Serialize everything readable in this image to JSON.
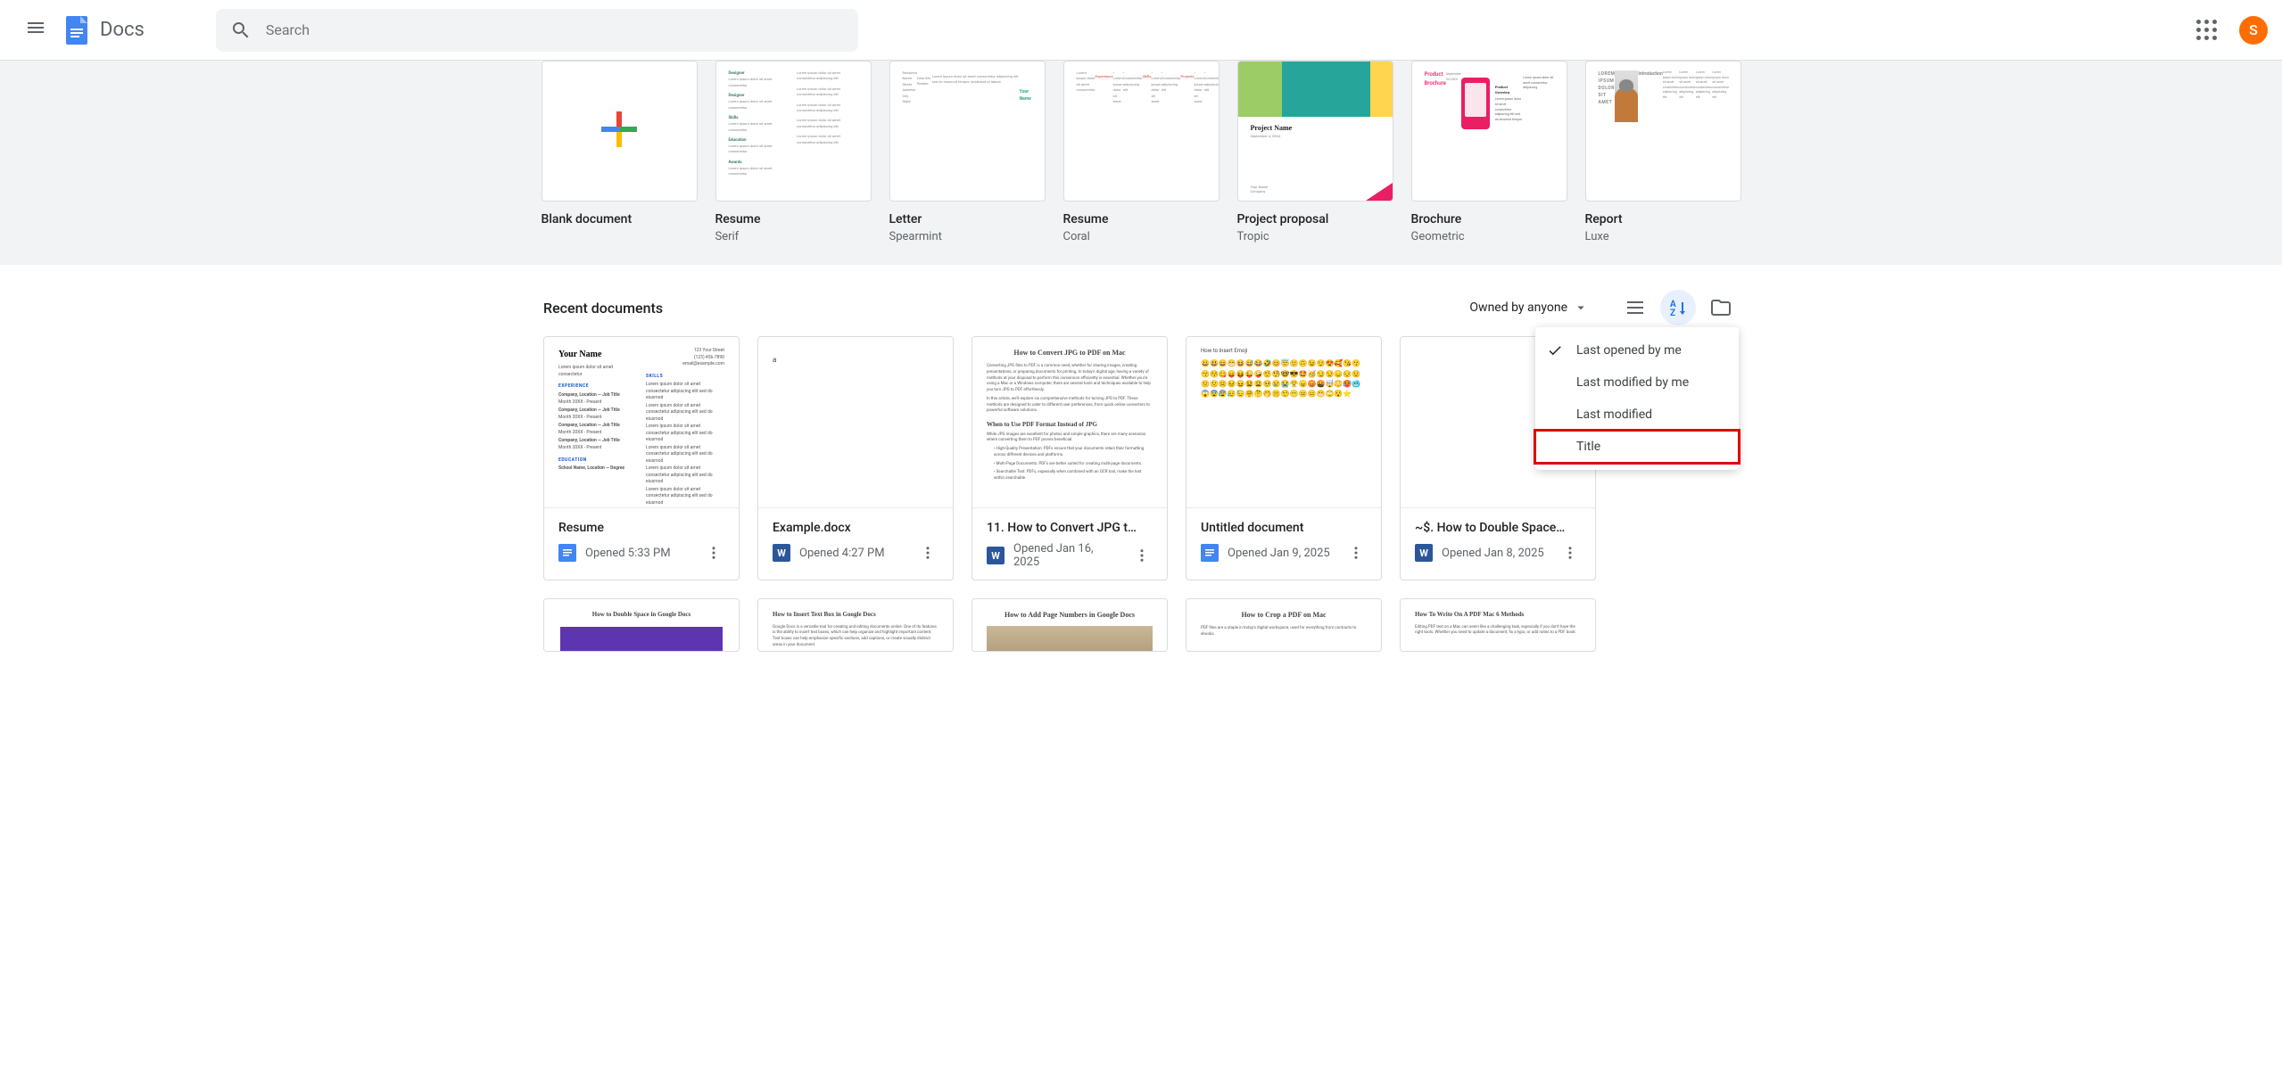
{
  "header": {
    "app_name": "Docs",
    "search_placeholder": "Search",
    "avatar_initial": "S"
  },
  "templates": [
    {
      "name": "Blank document",
      "subtitle": "",
      "type": "blank"
    },
    {
      "name": "Resume",
      "subtitle": "Serif",
      "type": "resume_serif"
    },
    {
      "name": "Letter",
      "subtitle": "Spearmint",
      "type": "letter"
    },
    {
      "name": "Resume",
      "subtitle": "Coral",
      "type": "resume_coral"
    },
    {
      "name": "Project proposal",
      "subtitle": "Tropic",
      "type": "proposal"
    },
    {
      "name": "Brochure",
      "subtitle": "Geometric",
      "type": "brochure"
    },
    {
      "name": "Report",
      "subtitle": "Luxe",
      "type": "report"
    }
  ],
  "recent": {
    "title": "Recent documents",
    "owner_filter": "Owned by anyone",
    "sort_options": [
      {
        "label": "Last opened by me",
        "selected": true,
        "highlighted": false
      },
      {
        "label": "Last modified by me",
        "selected": false,
        "highlighted": false
      },
      {
        "label": "Last modified",
        "selected": false,
        "highlighted": false
      },
      {
        "label": "Title",
        "selected": false,
        "highlighted": true
      }
    ],
    "documents": [
      {
        "name": "Resume",
        "date": "Opened 5:33 PM",
        "icon": "docs",
        "preview": "resume"
      },
      {
        "name": "Example.docx",
        "date": "Opened 4:27 PM",
        "icon": "word",
        "preview": "blank_a"
      },
      {
        "name": "11. How to Convert JPG t…",
        "date": "Opened Jan 16, 2025",
        "icon": "word",
        "preview": "article_jpg"
      },
      {
        "name": "Untitled document",
        "date": "Opened Jan 9, 2025",
        "icon": "docs",
        "preview": "emoji"
      },
      {
        "name": "~$. How to Double Space…",
        "date": "Opened Jan 8, 2025",
        "icon": "word",
        "preview": "empty"
      }
    ],
    "documents_row2": [
      {
        "preview_title": "How to Double Space in Google Docs",
        "preview": "dspace"
      },
      {
        "preview_title": "How to Insert Text Box in Google Docs",
        "preview": "article_textbox"
      },
      {
        "preview_title": "How to Add Page Numbers in Google Docs",
        "preview": "article_pagenum"
      },
      {
        "preview_title": "How to Crop a PDF on Mac",
        "preview": "article_crop"
      },
      {
        "preview_title": "How To Write On A PDF Mac 6 Methods",
        "preview": "article_write"
      }
    ]
  },
  "preview_text": {
    "resume_name": "Your Name",
    "emoji_line": "How to Insert Emoji",
    "article_jpg_title": "How to Convert JPG to PDF on Mac",
    "article_jpg_sub": "When to Use PDF Format Instead of JPG",
    "brochure_title": "Product Brochure",
    "brochure_overview": "Product Overview",
    "proposal_name": "Project Name",
    "report_title": "LOREM IPSUM DOLOR SIT AMET",
    "report_intro": "Introduction",
    "letter_name": "Your Name"
  }
}
